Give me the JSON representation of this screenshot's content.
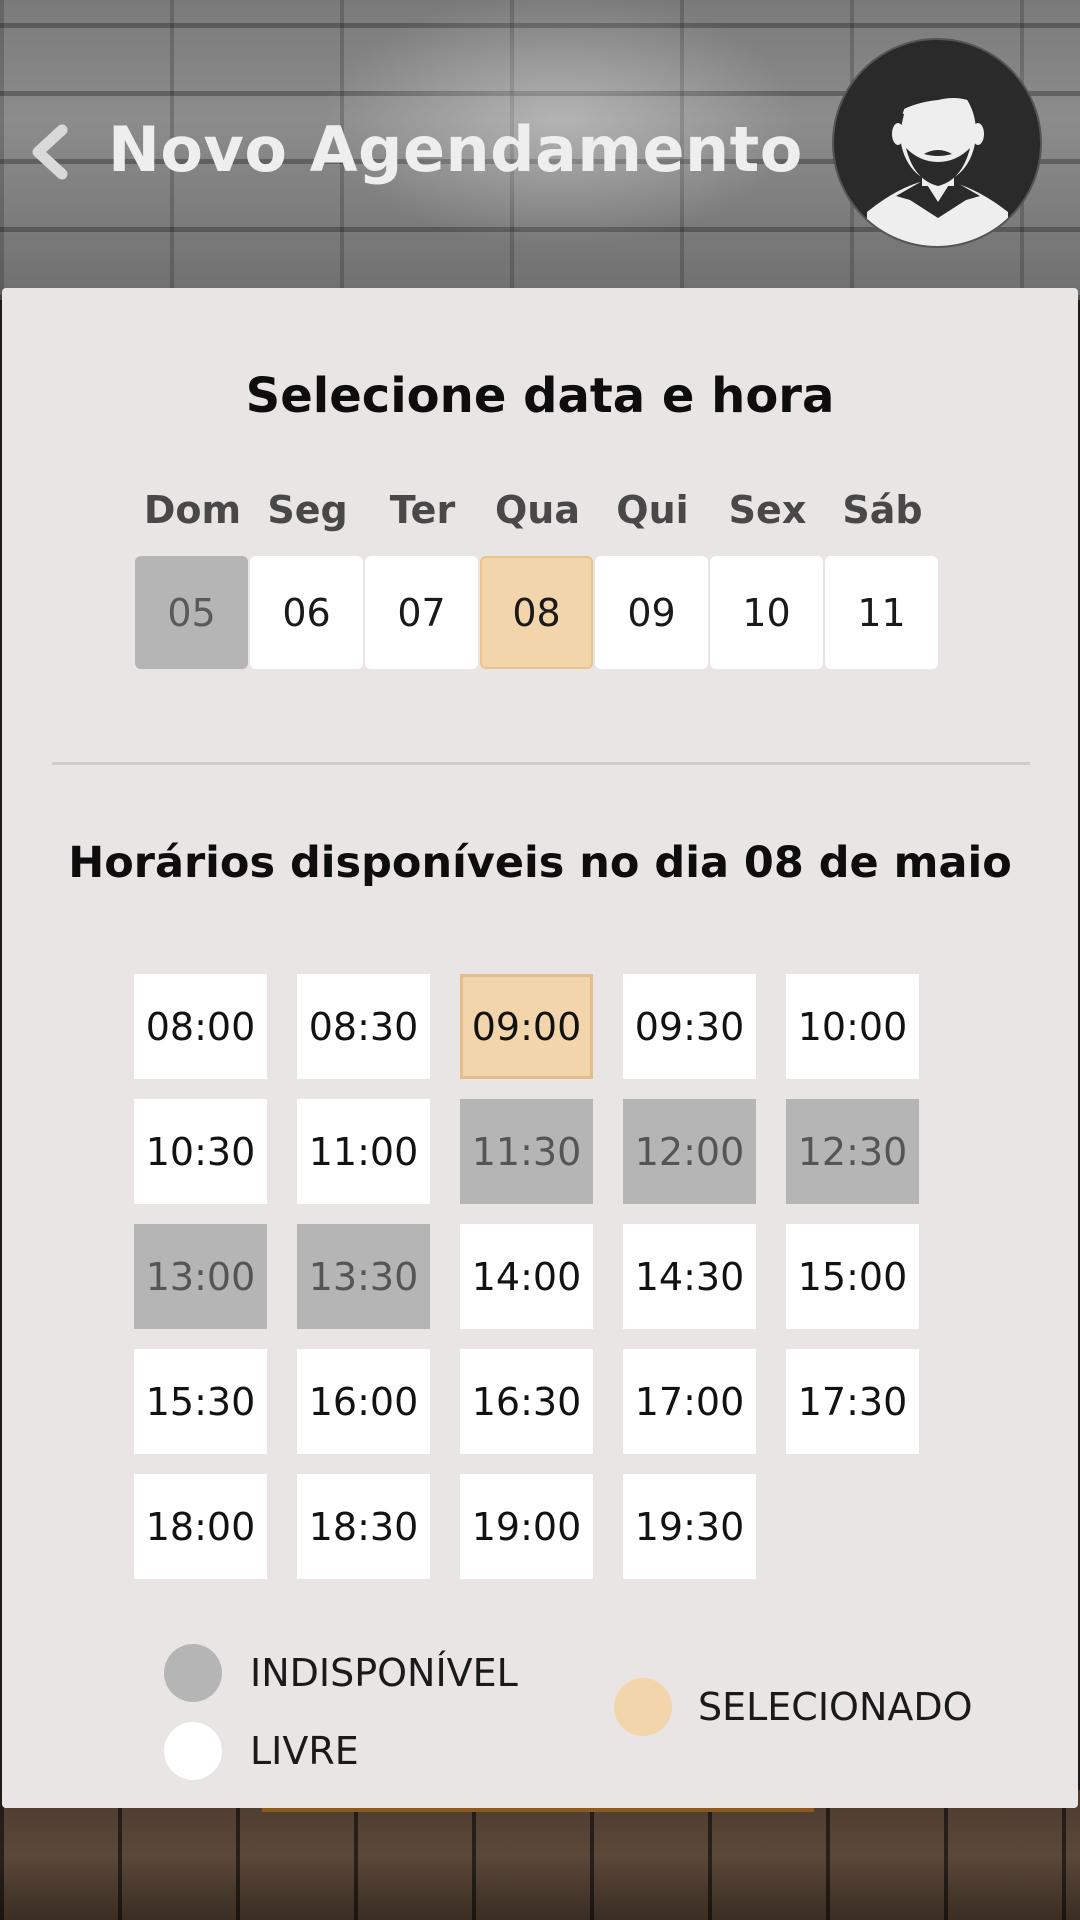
{
  "header": {
    "title": "Novo Agendamento",
    "back_icon": "chevron-left-icon",
    "avatar_icon": "bearded-man-avatar"
  },
  "date_picker": {
    "title": "Selecione data e hora",
    "weekdays": [
      "Dom",
      "Seg",
      "Ter",
      "Qua",
      "Qui",
      "Sex",
      "Sáb"
    ],
    "dates": [
      {
        "day": "05",
        "state": "unavailable"
      },
      {
        "day": "06",
        "state": "free"
      },
      {
        "day": "07",
        "state": "free"
      },
      {
        "day": "08",
        "state": "selected"
      },
      {
        "day": "09",
        "state": "free"
      },
      {
        "day": "10",
        "state": "free"
      },
      {
        "day": "11",
        "state": "free"
      }
    ]
  },
  "time_slots": {
    "title": "Horários disponíveis no dia 08 de maio",
    "slots": [
      {
        "time": "08:00",
        "state": "free"
      },
      {
        "time": "08:30",
        "state": "free"
      },
      {
        "time": "09:00",
        "state": "selected"
      },
      {
        "time": "09:30",
        "state": "free"
      },
      {
        "time": "10:00",
        "state": "free"
      },
      {
        "time": "10:30",
        "state": "free"
      },
      {
        "time": "11:00",
        "state": "free"
      },
      {
        "time": "11:30",
        "state": "unavailable"
      },
      {
        "time": "12:00",
        "state": "unavailable"
      },
      {
        "time": "12:30",
        "state": "unavailable"
      },
      {
        "time": "13:00",
        "state": "unavailable"
      },
      {
        "time": "13:30",
        "state": "unavailable"
      },
      {
        "time": "14:00",
        "state": "free"
      },
      {
        "time": "14:30",
        "state": "free"
      },
      {
        "time": "15:00",
        "state": "free"
      },
      {
        "time": "15:30",
        "state": "free"
      },
      {
        "time": "16:00",
        "state": "free"
      },
      {
        "time": "16:30",
        "state": "free"
      },
      {
        "time": "17:00",
        "state": "free"
      },
      {
        "time": "17:30",
        "state": "free"
      },
      {
        "time": "18:00",
        "state": "free"
      },
      {
        "time": "18:30",
        "state": "free"
      },
      {
        "time": "19:00",
        "state": "free"
      },
      {
        "time": "19:30",
        "state": "free"
      }
    ]
  },
  "legend": {
    "unavailable": "INDISPONÍVEL",
    "free": "LIVRE",
    "selected": "SELECIONADO"
  },
  "colors": {
    "selected": "#f2d5aa",
    "unavailable": "#b6b5b5",
    "free": "#ffffff",
    "card": "#e8e5e4"
  }
}
